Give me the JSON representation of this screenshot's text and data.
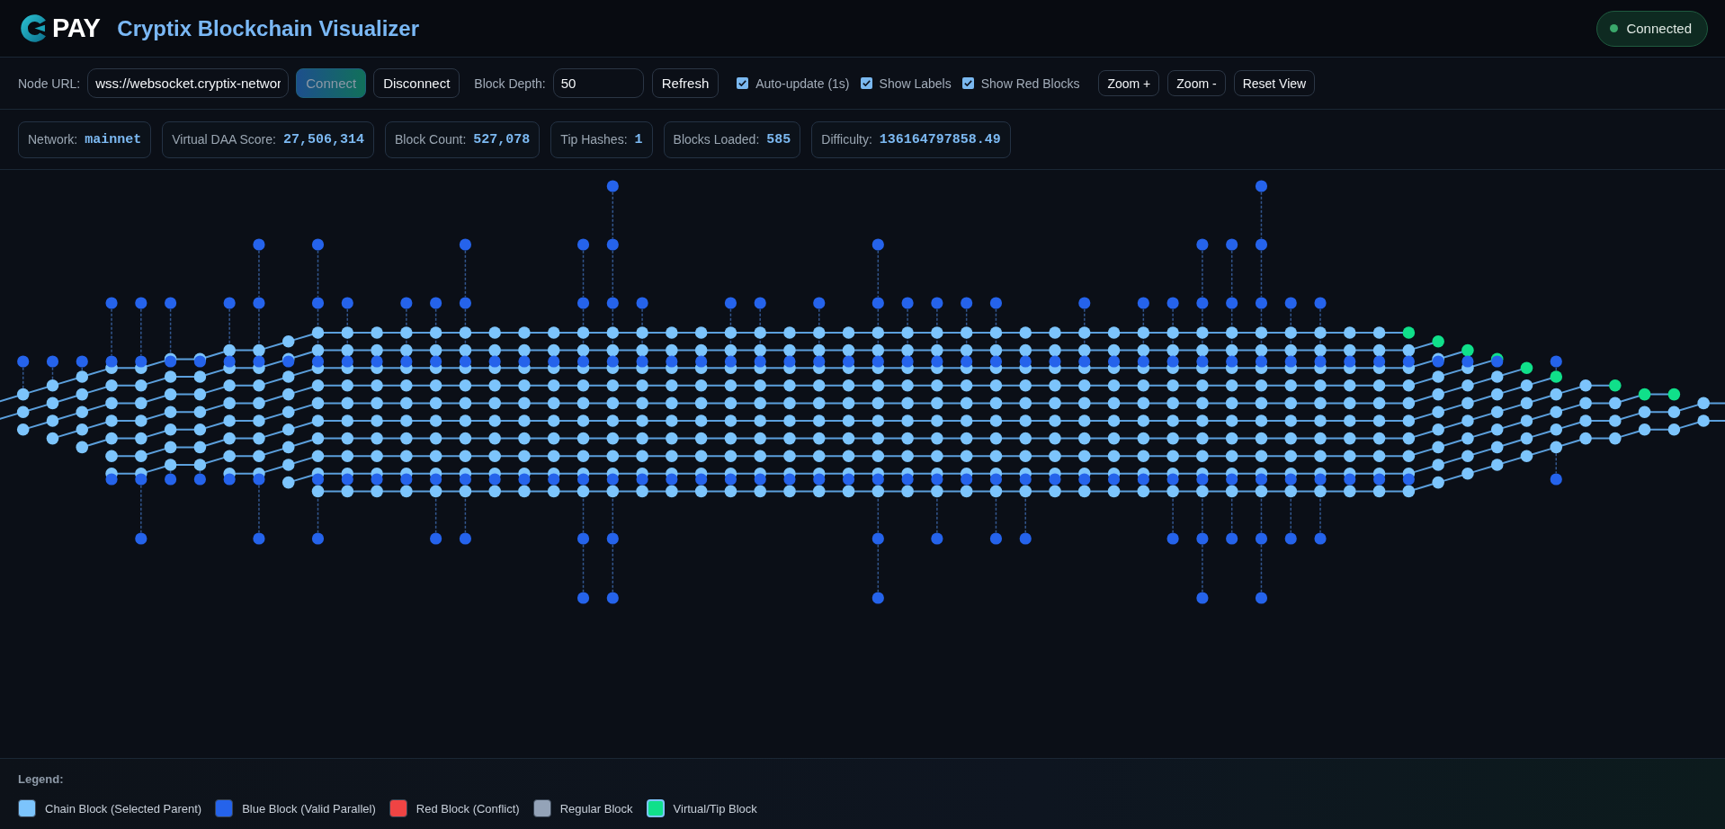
{
  "header": {
    "logo_text": "PAY",
    "title": "Cryptix Blockchain Visualizer",
    "status": {
      "label": "Connected",
      "connected": true
    }
  },
  "toolbar": {
    "node_url": {
      "label": "Node URL:",
      "value": "wss://websocket.cryptix-networ"
    },
    "connection_buttons": [
      {
        "label": "Connect",
        "kind": "primary",
        "disabled": true
      },
      {
        "label": "Disconnect",
        "kind": "default",
        "disabled": false
      }
    ],
    "block_depth": {
      "label": "Block Depth:",
      "value": "50"
    },
    "refresh_button": {
      "label": "Refresh"
    },
    "options": [
      {
        "label": "Auto-update (1s)",
        "checked": true
      },
      {
        "label": "Show Labels",
        "checked": true
      },
      {
        "label": "Show Red Blocks",
        "checked": true
      }
    ],
    "view_buttons": [
      {
        "label": "Zoom +"
      },
      {
        "label": "Zoom -"
      },
      {
        "label": "Reset View"
      }
    ]
  },
  "stats": [
    {
      "label": "Network:",
      "value": "mainnet"
    },
    {
      "label": "Virtual DAA Score:",
      "value": "27,506,314"
    },
    {
      "label": "Block Count:",
      "value": "527,078"
    },
    {
      "label": "Tip Hashes:",
      "value": "1"
    },
    {
      "label": "Blocks Loaded:",
      "value": "585"
    },
    {
      "label": "Difficulty:",
      "value": "136164797858.49"
    }
  ],
  "legend": {
    "title": "Legend:",
    "items": [
      {
        "label": "Chain Block (Selected Parent)",
        "kind": "chain",
        "color": "#7cc4fc"
      },
      {
        "label": "Blue Block (Valid Parallel)",
        "kind": "blue",
        "color": "#2563eb"
      },
      {
        "label": "Red Block (Conflict)",
        "kind": "red",
        "color": "#ef4444"
      },
      {
        "label": "Regular Block",
        "kind": "regular",
        "color": "#94a3b8"
      },
      {
        "label": "Virtual/Tip Block",
        "kind": "tip",
        "color": "#10e08a"
      }
    ]
  }
}
